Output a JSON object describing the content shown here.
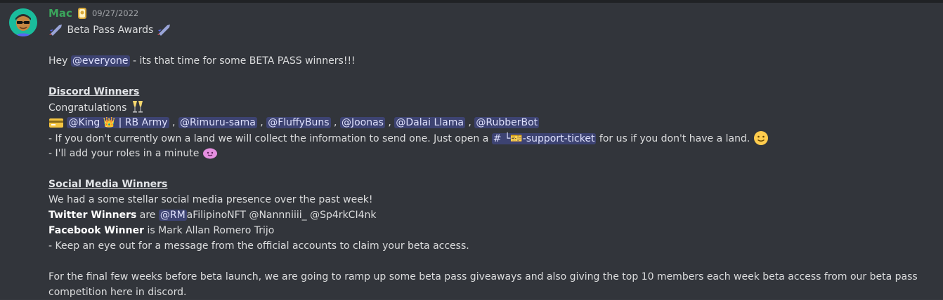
{
  "message": {
    "author": "Mac",
    "timestamp": "09/27/2022",
    "title": "Beta Pass Awards",
    "greeting_pre": "Hey ",
    "greeting_mention": "@everyone",
    "greeting_post": " - its that time for some BETA PASS winners!!!",
    "discord": {
      "heading": "Discord Winners",
      "congrats": "Congratulations",
      "winners": [
        "@King 👑 | RB Army",
        "@Rimuru-sama",
        "@FluffyBuns",
        "@Joonas",
        "@Dalai Llama",
        "@RubberBot"
      ],
      "info_pre": "- If you don't currently own a land we will collect the information to send one. Just open a ",
      "channel": "# └🎫-support-ticket",
      "info_post": " for us if you don't have a land.",
      "roles": "- I'll add your roles in a minute"
    },
    "social": {
      "heading": "Social Media Winners",
      "intro": "We had a some stellar social media presence over the past week!",
      "twitter_label": "Twitter Winners",
      "twitter_are": " are ",
      "twitter_mention": "@RM",
      "twitter_rest": "aFilipinoNFT @Nannniiii_ @Sp4rkCI4nk",
      "facebook_label": "Facebook Winner",
      "facebook_rest": " is Mark Allan Romero Trijo",
      "note": "- Keep an eye out for a message from the official accounts to claim your beta access."
    },
    "closing": "For the final few weeks before beta launch, we are going to ramp up some beta pass giveaways and also giving the top 10 members each week beta access from our beta pass competition here in discord."
  },
  "icons": {
    "avatar": "avatar-icon",
    "badge": "server-badge-icon",
    "rocket": "rocket-icon",
    "champagne": "champagne-icon",
    "card": "credit-card-icon",
    "smile": "smile-icon",
    "blob": "blob-emoji-icon"
  },
  "colors": {
    "background": "#36393f",
    "message_bg": "#32353b",
    "author": "#3ba55c",
    "mention_bg": "rgba(88,101,242,0.3)"
  }
}
